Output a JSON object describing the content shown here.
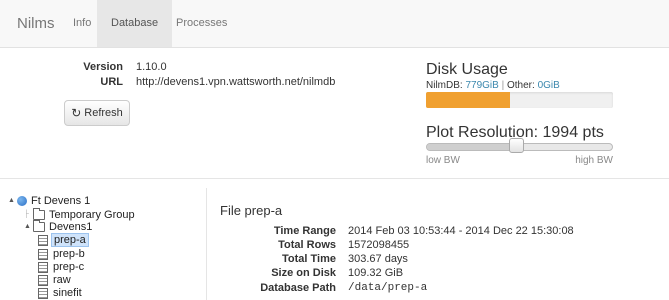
{
  "navbar": {
    "brand": "Nilms",
    "tabs": [
      {
        "label": "Info"
      },
      {
        "label": "Database"
      },
      {
        "label": "Processes"
      }
    ],
    "active_tab": "Database"
  },
  "info": {
    "version_label": "Version",
    "version": "1.10.0",
    "url_label": "URL",
    "url": "http://devens1.vpn.wattsworth.net/nilmdb"
  },
  "refresh_button": {
    "label": "Refresh",
    "icon": "refresh-icon"
  },
  "disk_usage": {
    "title": "Disk Usage",
    "nilmdb_label": "NilmDB:",
    "nilmdb_value": "779GiB",
    "separator": "|",
    "other_label": "Other:",
    "other_value": "0GiB",
    "fill_fraction": 0.45,
    "fill_color": "#f0a030"
  },
  "plot_resolution": {
    "title": "Plot Resolution: 1994 pts",
    "slider_fraction": 0.48,
    "low_label": "low BW",
    "high_label": "high BW"
  },
  "tree": {
    "root": "Ft Devens 1",
    "items": [
      {
        "label": "Temporary Group",
        "type": "folder"
      },
      {
        "label": "Devens1",
        "type": "folder"
      },
      {
        "label": "prep-a",
        "type": "file",
        "selected": true
      },
      {
        "label": "prep-b",
        "type": "file"
      },
      {
        "label": "prep-c",
        "type": "file"
      },
      {
        "label": "raw",
        "type": "file"
      },
      {
        "label": "sinefit",
        "type": "file"
      }
    ]
  },
  "file": {
    "title": "File prep-a",
    "rows": [
      {
        "label": "Time Range",
        "value": "2014 Feb 03 10:53:44 - 2014 Dec 22 15:30:08"
      },
      {
        "label": "Total Rows",
        "value": "1572098455"
      },
      {
        "label": "Total Time",
        "value": "303.67 days"
      },
      {
        "label": "Size on Disk",
        "value": "109.32 GiB"
      },
      {
        "label": "Database Path",
        "value": "/data/prep-a"
      }
    ]
  },
  "colors": {
    "accent_link": "#3a87ad",
    "progress": "#f0a030",
    "selected_bg": "#cfe3fa"
  }
}
